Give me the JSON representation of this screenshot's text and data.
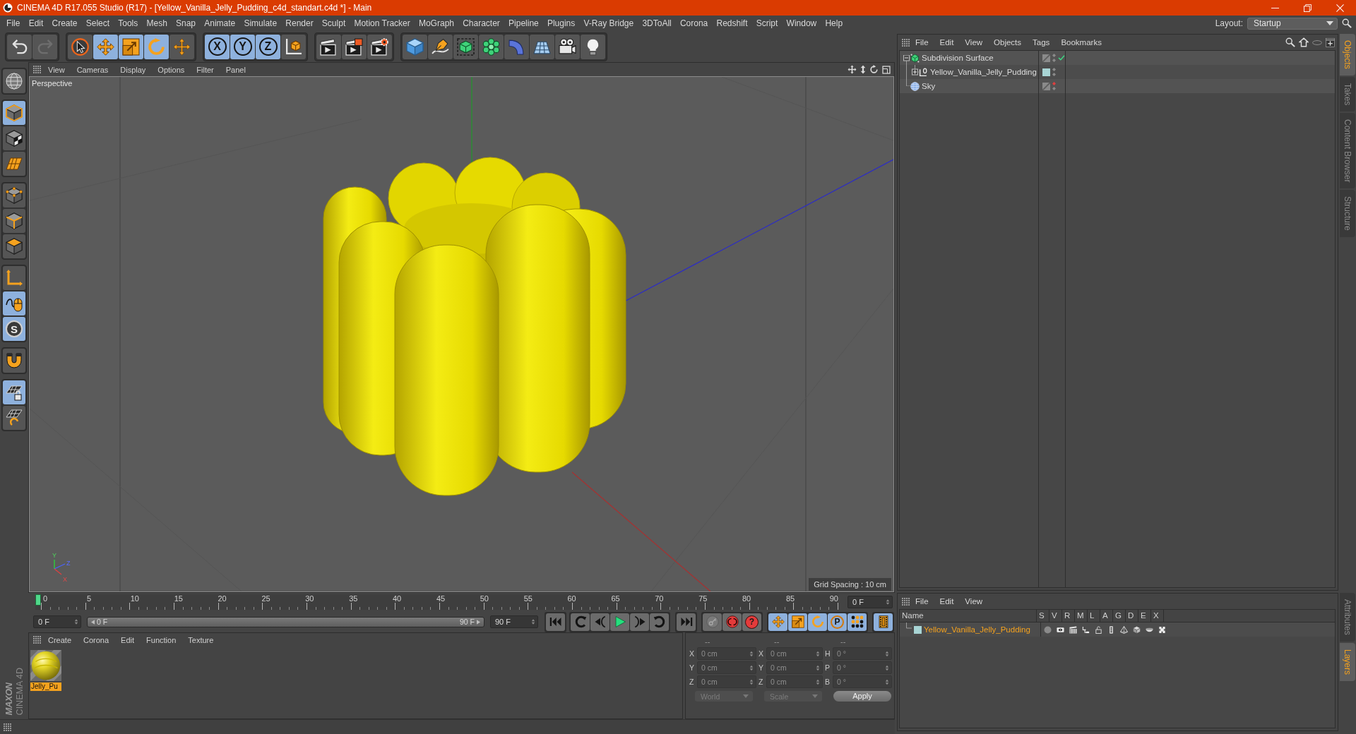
{
  "window": {
    "title": "CINEMA 4D R17.055 Studio (R17) - [Yellow_Vanilla_Jelly_Pudding_c4d_standart.c4d *] - Main"
  },
  "menu_bar": {
    "items": [
      "File",
      "Edit",
      "Create",
      "Select",
      "Tools",
      "Mesh",
      "Snap",
      "Animate",
      "Simulate",
      "Render",
      "Sculpt",
      "Motion Tracker",
      "MoGraph",
      "Character",
      "Pipeline",
      "Plugins",
      "V-Ray Bridge",
      "3DToAll",
      "Corona",
      "Redshift",
      "Script",
      "Window",
      "Help"
    ],
    "layout_label": "Layout:",
    "layout_value": "Startup"
  },
  "toolbar": {
    "history": [
      {
        "kind": "undo",
        "disabled": false
      },
      {
        "kind": "redo",
        "disabled": true
      }
    ],
    "groups": [
      {
        "items": [
          {
            "kind": "select",
            "active": false
          },
          {
            "kind": "move",
            "active": true
          },
          {
            "kind": "scale",
            "active": true
          },
          {
            "kind": "rotate",
            "active": true
          },
          {
            "kind": "transform",
            "active": false
          }
        ]
      },
      {
        "items": [
          {
            "kind": "axis_x",
            "label": "X",
            "active": true
          },
          {
            "kind": "axis_y",
            "label": "Y",
            "active": true
          },
          {
            "kind": "axis_z",
            "label": "Z",
            "active": true
          },
          {
            "kind": "coord",
            "active": false
          }
        ]
      },
      {
        "items": [
          {
            "kind": "render_region",
            "active": false
          },
          {
            "kind": "render_view",
            "active": false
          },
          {
            "kind": "render_settings",
            "active": false
          }
        ]
      },
      {
        "items": [
          {
            "kind": "cube",
            "active": false
          },
          {
            "kind": "pen",
            "active": false
          },
          {
            "kind": "subdivision",
            "active": false
          },
          {
            "kind": "cloner",
            "active": false
          },
          {
            "kind": "deformer",
            "active": false
          },
          {
            "kind": "floor",
            "active": false
          },
          {
            "kind": "camera",
            "active": false
          },
          {
            "kind": "light",
            "active": false
          }
        ]
      }
    ]
  },
  "left_toolbar": {
    "groups": [
      {
        "items": [
          {
            "kind": "model_mode",
            "active": false
          }
        ]
      },
      {
        "items": [
          {
            "kind": "object_mode",
            "active": true
          },
          {
            "kind": "texture_mode",
            "active": false
          },
          {
            "kind": "workplane_mode",
            "active": false
          }
        ]
      },
      {
        "items": [
          {
            "kind": "points_mode",
            "active": false
          },
          {
            "kind": "edges_mode",
            "active": false
          },
          {
            "kind": "polygons_mode",
            "active": false
          }
        ]
      },
      {
        "items": [
          {
            "kind": "axis_mode",
            "active": false
          },
          {
            "kind": "tweak_mode",
            "active": true
          },
          {
            "kind": "solo",
            "label": "S",
            "active": true
          }
        ]
      },
      {
        "items": [
          {
            "kind": "snap",
            "active": false
          }
        ]
      },
      {
        "items": [
          {
            "kind": "workplane_lock",
            "active": true
          },
          {
            "kind": "workplane_align",
            "active": false
          }
        ]
      }
    ]
  },
  "viewport": {
    "menu": [
      "View",
      "Cameras",
      "Display",
      "Options",
      "Filter",
      "Panel"
    ],
    "camera": "Perspective",
    "grid_spacing": "Grid Spacing : 10 cm",
    "axis_labels": [
      "Y",
      "Z",
      "X"
    ]
  },
  "timeline": {
    "ticks": [
      "0",
      "5",
      "10",
      "15",
      "20",
      "25",
      "30",
      "35",
      "40",
      "45",
      "50",
      "55",
      "60",
      "65",
      "70",
      "75",
      "80",
      "85",
      "90"
    ],
    "playhead": {
      "level": 0
    },
    "current_frame": "0 F",
    "start_field": "0 F",
    "range_start": "0 F",
    "range_end": "90 F",
    "end_field": "90 F",
    "transport": [
      {
        "items": [
          {
            "kind": "go_start"
          }
        ]
      },
      {
        "items": [
          {
            "kind": "prev_key"
          },
          {
            "kind": "prev_frame"
          },
          {
            "kind": "play"
          },
          {
            "kind": "next_frame"
          },
          {
            "kind": "next_key"
          }
        ]
      },
      {
        "items": [
          {
            "kind": "go_end"
          }
        ]
      },
      {
        "items": [
          {
            "kind": "key_selection"
          },
          {
            "kind": "record"
          },
          {
            "kind": "autokey",
            "label": "?"
          }
        ]
      },
      {
        "items": [
          {
            "kind": "key_position",
            "active": true
          },
          {
            "kind": "key_scale",
            "active": true
          },
          {
            "kind": "key_rotation",
            "active": true
          },
          {
            "kind": "key_parameter",
            "label": "P",
            "active": true
          },
          {
            "kind": "key_pla",
            "active": true
          }
        ]
      },
      {
        "items": [
          {
            "kind": "timeline_view",
            "active": true
          }
        ]
      }
    ]
  },
  "material_manager": {
    "menu": [
      "Create",
      "Corona",
      "Edit",
      "Function",
      "Texture"
    ],
    "materials": [
      {
        "name": "Jelly_Pu",
        "selected": true
      }
    ]
  },
  "coordinates": {
    "headers": [
      "--",
      "--",
      "--"
    ],
    "rows": [
      {
        "fields": [
          {
            "label": "X",
            "value": "0 cm"
          },
          {
            "label": "X",
            "value": "0 cm"
          },
          {
            "label": "H",
            "value": "0 °"
          }
        ]
      },
      {
        "fields": [
          {
            "label": "Y",
            "value": "0 cm"
          },
          {
            "label": "Y",
            "value": "0 cm"
          },
          {
            "label": "P",
            "value": "0 °"
          }
        ]
      },
      {
        "fields": [
          {
            "label": "Z",
            "value": "0 cm"
          },
          {
            "label": "Z",
            "value": "0 cm"
          },
          {
            "label": "B",
            "value": "0 °"
          }
        ]
      }
    ],
    "dropdowns": [
      {
        "value": "World",
        "disabled": true
      },
      {
        "value": "Scale",
        "disabled": true
      }
    ],
    "apply": "Apply"
  },
  "logo": {
    "brand": "MAXON",
    "product": "CINEMA 4D"
  },
  "object_manager": {
    "menu": [
      "File",
      "Edit",
      "View",
      "Objects",
      "Tags",
      "Bookmarks"
    ],
    "objects": [
      {
        "name": "Subdivision Surface",
        "kind": "subdivision",
        "expanded": true,
        "editor_visible": true,
        "render_visible": true,
        "enabled": true,
        "children": [
          {
            "name": "Yellow_Vanilla_Jelly_Pudding",
            "kind": "null",
            "expanded": false,
            "color": "#a8d4d4",
            "editor_visible": true,
            "render_visible": true
          }
        ]
      },
      {
        "name": "Sky",
        "kind": "sky",
        "editor_visible": false,
        "render_visible": true
      }
    ]
  },
  "layer_manager": {
    "menu": [
      "File",
      "Edit",
      "View"
    ],
    "columns": [
      "Name",
      "S",
      "V",
      "R",
      "M",
      "L",
      "A",
      "G",
      "D",
      "E",
      "X"
    ],
    "layers": [
      {
        "name": "Yellow_Vanilla_Jelly_Pudding",
        "color": "#a8d4d4",
        "selected": true
      }
    ]
  },
  "side_tabs": {
    "top": [
      {
        "label": "Objects",
        "selected": true
      },
      {
        "label": "Takes",
        "selected": false
      },
      {
        "label": "Content Browser",
        "selected": false
      },
      {
        "label": "Structure",
        "selected": false
      }
    ],
    "bottom": [
      {
        "label": "Attributes",
        "selected": false
      },
      {
        "label": "Layers",
        "selected": true
      }
    ]
  }
}
